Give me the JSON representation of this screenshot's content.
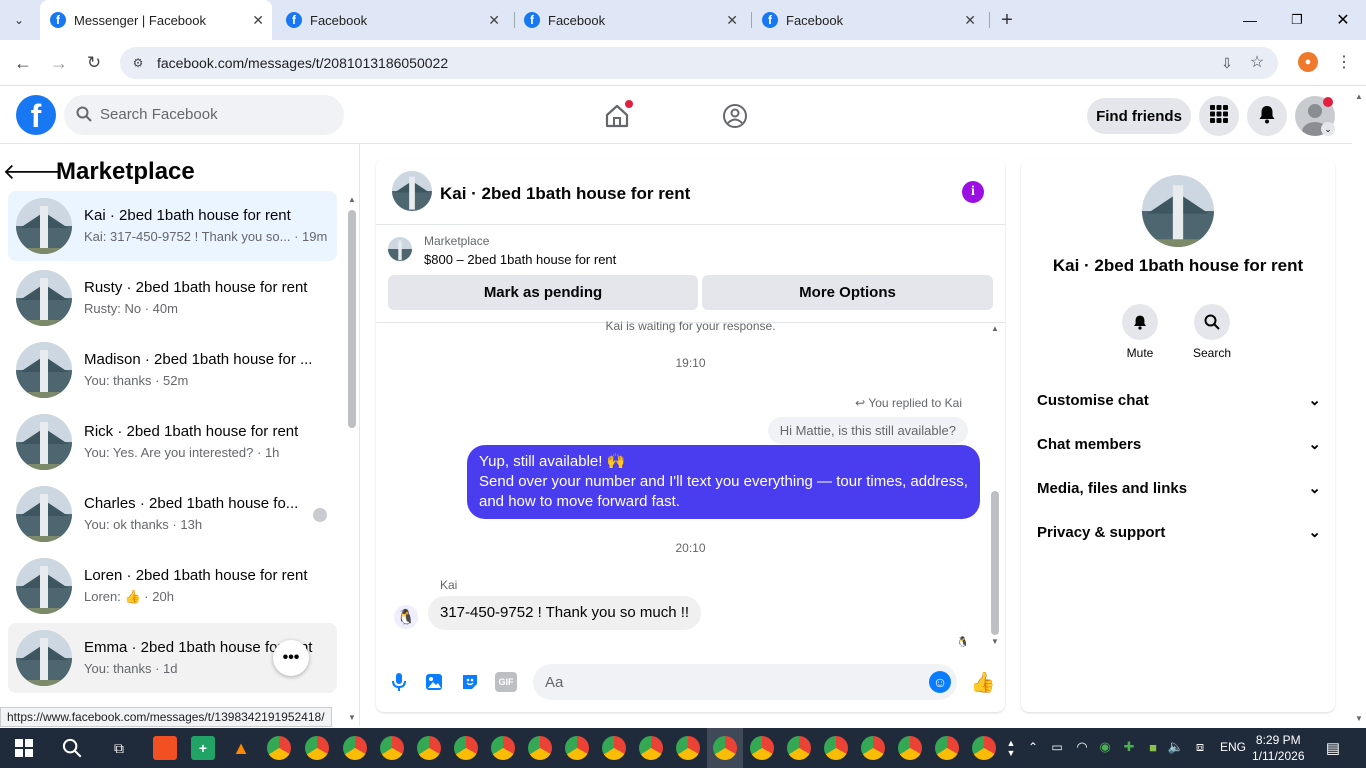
{
  "browser": {
    "tabs": [
      {
        "title": "Messenger | Facebook",
        "active": true
      },
      {
        "title": "Facebook",
        "active": false
      },
      {
        "title": "Facebook",
        "active": false
      },
      {
        "title": "Facebook",
        "active": false
      }
    ],
    "url": "facebook.com/messages/t/2081013186050022",
    "status_url": "https://www.facebook.com/messages/t/1398342191952418/"
  },
  "fb_header": {
    "search_placeholder": "Search Facebook",
    "find_friends": "Find friends"
  },
  "left_panel": {
    "title": "Marketplace",
    "conversations": [
      {
        "name": "Kai · 2bed 1bath house for rent",
        "preview": "Kai: 317-450-9752 ! Thank you so...",
        "time": "19m"
      },
      {
        "name": "Rusty · 2bed 1bath house for rent",
        "preview": "Rusty: No",
        "time": "40m"
      },
      {
        "name": "Madison · 2bed 1bath house for ...",
        "preview": "You: thanks",
        "time": "52m"
      },
      {
        "name": "Rick · 2bed 1bath house for rent",
        "preview": "You: Yes. Are you interested?",
        "time": "1h"
      },
      {
        "name": "Charles · 2bed 1bath house fo...",
        "preview": "You: ok thanks",
        "time": "13h"
      },
      {
        "name": "Loren · 2bed 1bath house for rent",
        "preview": "Loren: 👍",
        "time": "20h"
      },
      {
        "name": "Emma · 2bed 1bath house for rent",
        "preview": "You: thanks",
        "time": "1d"
      }
    ]
  },
  "chat": {
    "title": "Kai · 2bed 1bath house for rent",
    "marketplace_label": "Marketplace",
    "listing": "$800 – 2bed 1bath house for rent",
    "mark_pending": "Mark as pending",
    "more_options": "More Options",
    "waiting": "Kai is waiting for your response.",
    "time1": "19:10",
    "replied_to": "You replied to Kai",
    "quoted": "Hi Mattie, is this still available?",
    "outgoing_line1": "Yup, still available! 🙌",
    "outgoing_line2": "Send over your number and I'll text you everything — tour times, address, and how to move forward fast.",
    "time2": "20:10",
    "sender": "Kai",
    "incoming": "317-450-9752 ! Thank you so much !!",
    "composer_placeholder": "Aa"
  },
  "info_panel": {
    "title": "Kai · 2bed 1bath house for rent",
    "mute": "Mute",
    "search": "Search",
    "items": [
      "Customise chat",
      "Chat members",
      "Media, files and links",
      "Privacy & support"
    ]
  },
  "taskbar": {
    "lang": "ENG",
    "time": "8:29 PM",
    "date": "1/11/2026"
  },
  "colors": {
    "fb_blue": "#1877f2",
    "bubble": "#4a3df0",
    "selected": "#ebf5ff"
  }
}
